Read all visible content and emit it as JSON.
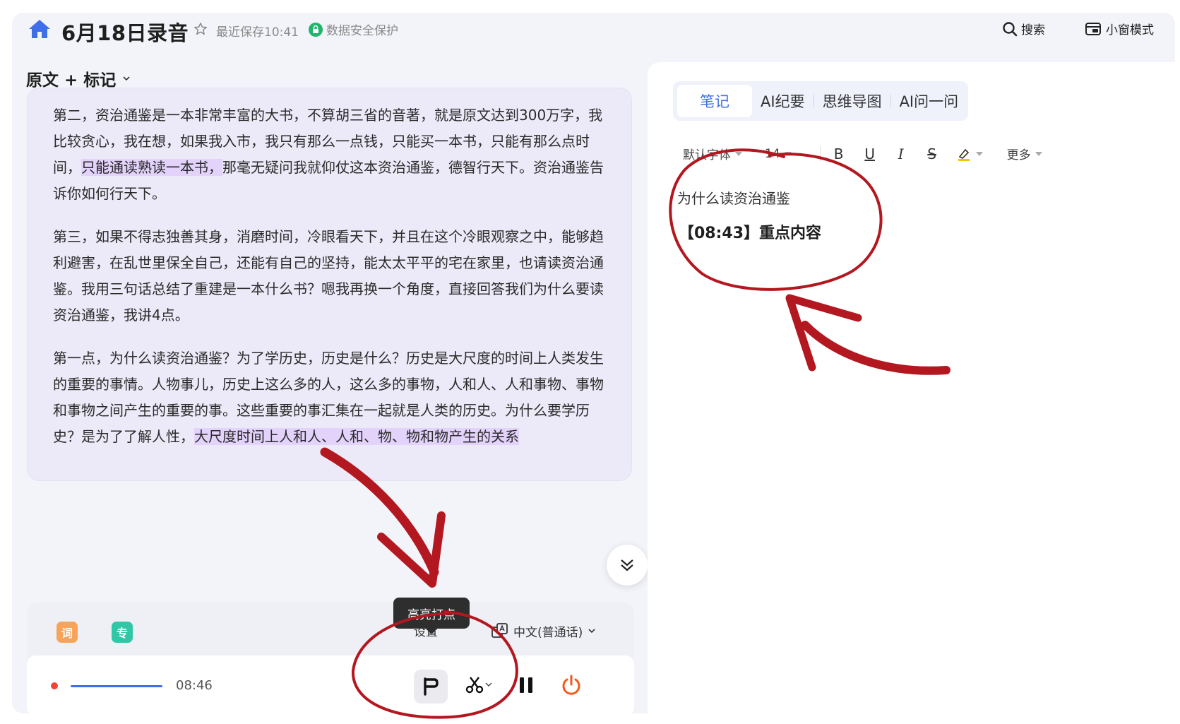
{
  "header": {
    "title": "6月18日录音",
    "saved_text": "最近保存10:41",
    "secure_text": "数据安全保护",
    "search_label": "搜索",
    "mini_label": "小窗模式"
  },
  "left": {
    "section_label": "原文 + 标记",
    "paragraphs": [
      {
        "before": "第二，资治通鉴是一本非常丰富的大书，不算胡三省的音著，就是原文达到300万字，我比较贪心，我在想，如果我入市，我只有那么一点钱，只能买一本书，只能有那么点时间，",
        "highlight": "只能通读熟读一本书，",
        "after": "那毫无疑问我就仰仗这本资治通鉴，德智行天下。资治通鉴告诉你如何行天下。"
      },
      {
        "before": "第三，如果不得志独善其身，消磨时间，冷眼看天下，并且在这个冷眼观察之中，能够趋利避害，在乱世里保全自己，还能有自己的坚持，能太太平平的宅在家里，也请读资治通鉴。我用三句话总结了重建是一本什么书？嗯我再换一个角度，直接回答我们为什么要读资治通鉴，我讲4点。",
        "highlight": "",
        "after": ""
      },
      {
        "before": "第一点，为什么读资治通鉴？为了学历史，历史是什么？历史是大尺度的时间上人类发生的重要的事情。人物事儿，历史上这么多的人，这么多的事物，人和人、人和事物、事物和事物之间产生的重要的事。这些重要的事汇集在一起就是人类的历史。为什么要学历史？是为了了解人性，",
        "highlight": "大尺度时间上人和人、人和、物、物和物产生的关系",
        "after": ""
      }
    ],
    "badge_word": "词",
    "badge_pro": "专",
    "hidden_label": "设置",
    "language": "中文(普通话)",
    "player_time": "08:46",
    "tooltip": "高亮打点"
  },
  "notes": {
    "tabs": [
      "笔记",
      "AI纪要",
      "思维导图",
      "AI问一问"
    ],
    "font_family_label": "默认字体",
    "font_size_label": "14",
    "format_buttons": [
      "B",
      "U",
      "I",
      "S"
    ],
    "more_label": "更多",
    "heading": "为什么读资治通鉴",
    "mark": "【08:43】重点内容"
  },
  "colors": {
    "accent": "#3f6fe8",
    "highlight": "#e3d3fb",
    "annotation": "#b3171f",
    "record": "#f44336",
    "power": "#f25a1c"
  },
  "icons": [
    "home-icon",
    "star-icon",
    "lock-icon",
    "search-icon",
    "mini-window-icon",
    "chevron-down-icon",
    "double-chevron-down-icon",
    "flag-icon",
    "scissors-icon",
    "pause-icon",
    "power-icon",
    "translate-icon",
    "highlighter-icon"
  ]
}
